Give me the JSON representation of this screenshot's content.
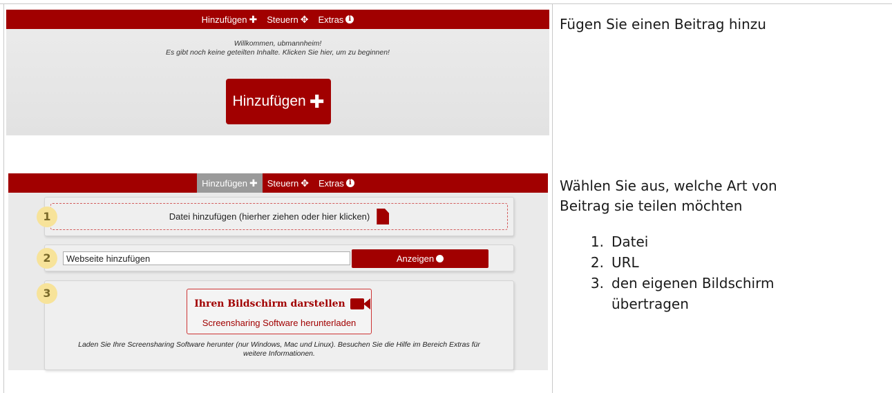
{
  "nav": {
    "add_label": "Hinzufügen",
    "add_icon": "plus-icon",
    "control_label": "Steuern",
    "control_icon": "move-arrows-icon",
    "extras_label": "Extras",
    "extras_icon": "info-circle-icon"
  },
  "shot1": {
    "welcome_line1": "Willkommen, ubmannheim!",
    "welcome_line2": "Es gibt noch keine geteilten Inhalte. Klicken Sie hier, um zu beginnen!",
    "big_add_label": "Hinzufügen"
  },
  "shot2": {
    "step1_number": "1",
    "file_dropzone_label": "Datei hinzufügen (hierher ziehen oder hier klicken)",
    "step2_number": "2",
    "url_input_value": "Webseite hinzufügen",
    "show_button_label": "Anzeigen",
    "step3_number": "3",
    "screen_button_title": "Ihren Bildschirm darstellen",
    "screen_download_link": "Screensharing Software herunterladen",
    "hint_line1": "Laden Sie Ihre Screensharing Software herunter (nur Windows, Mac und Linux). Besuchen Sie die Hilfe im Bereich Extras für",
    "hint_line2": "weitere Informationen."
  },
  "right": {
    "caption1": "Fügen Sie einen Beitrag hinzu",
    "caption2_line1": "Wählen Sie aus, welche Art von",
    "caption2_line2": "Beitrag sie teilen möchten",
    "list": [
      {
        "num": "1.",
        "text": "Datei"
      },
      {
        "num": "2.",
        "text": "URL"
      },
      {
        "num": "3.",
        "text": "den eigenen Bildschirm"
      }
    ],
    "list_item3_line2": "übertragen"
  },
  "colors": {
    "brand_red": "#a10000",
    "badge_yellow": "#f7e39a",
    "active_tab_gray": "#9a9a9a"
  }
}
